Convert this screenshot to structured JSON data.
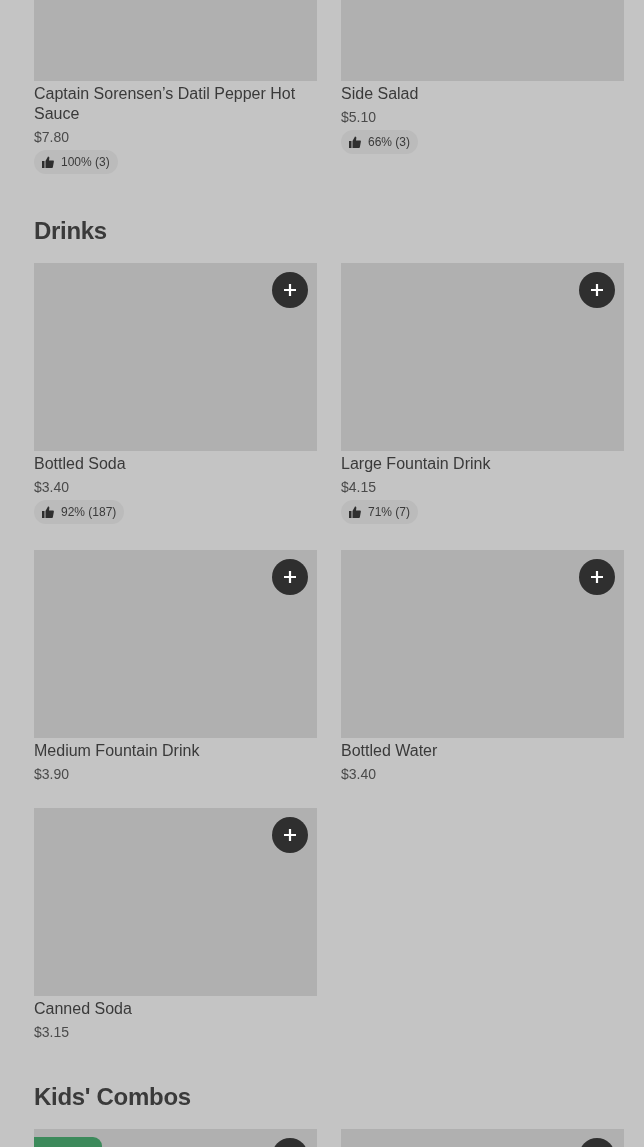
{
  "sections": [
    {
      "items": [
        {
          "name": "Captain Sorensen’s Datil Pepper Hot Sauce",
          "price": "$7.80",
          "rating": "100% (3)"
        },
        {
          "name": "Side Salad",
          "price": "$5.10",
          "rating": "66% (3)"
        }
      ]
    },
    {
      "title": "Drinks",
      "items": [
        {
          "name": "Bottled Soda",
          "price": "$3.40",
          "rating": "92% (187)",
          "add_button": true
        },
        {
          "name": "Large Fountain Drink",
          "price": "$4.15",
          "rating": "71% (7)",
          "add_button": true
        },
        {
          "name": "Medium Fountain Drink",
          "price": "$3.90",
          "add_button": true
        },
        {
          "name": "Bottled Water",
          "price": "$3.40",
          "add_button": true
        },
        {
          "name": "Canned Soda",
          "price": "$3.15",
          "add_button": true
        }
      ]
    },
    {
      "title": "Kids' Combos",
      "items": [
        {
          "add_button": true,
          "badge": true
        },
        {
          "add_button": true
        }
      ]
    }
  ]
}
